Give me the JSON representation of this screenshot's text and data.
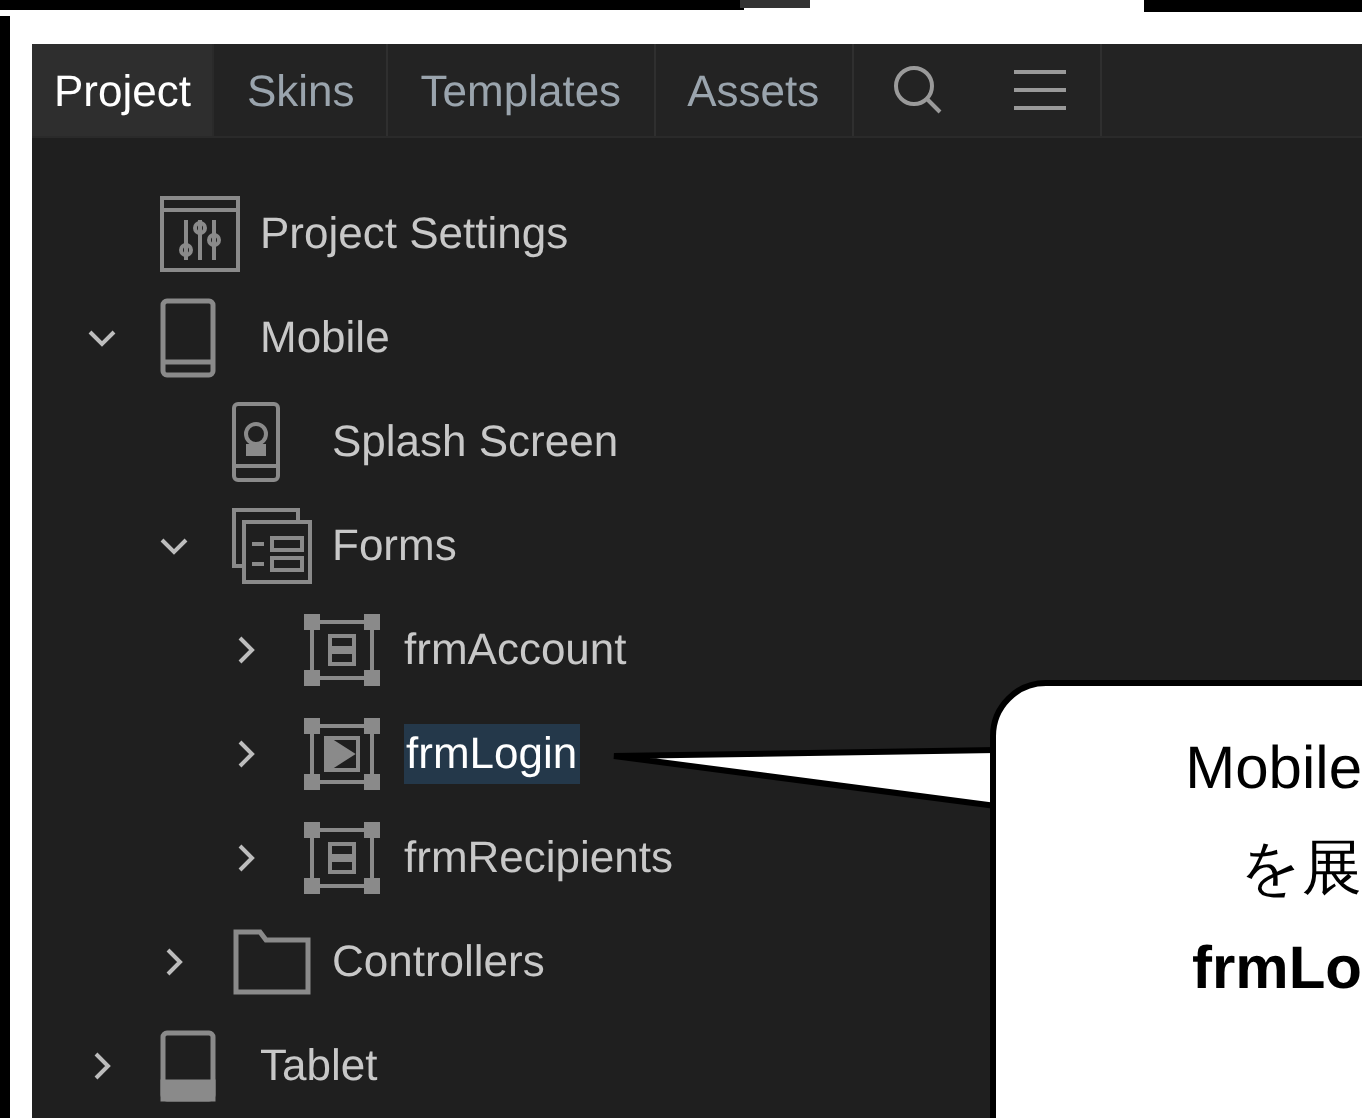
{
  "tabs": [
    {
      "label": "Project",
      "selected": true
    },
    {
      "label": "Skins",
      "selected": false
    },
    {
      "label": "Templates",
      "selected": false
    },
    {
      "label": "Assets",
      "selected": false
    }
  ],
  "tree": [
    {
      "label": "Project Settings",
      "kind": "settings",
      "selected": false
    },
    {
      "label": "Mobile",
      "kind": "phone",
      "expanded": true,
      "selected": false,
      "children": [
        {
          "label": "Splash Screen",
          "kind": "splash",
          "selected": false
        },
        {
          "label": "Forms",
          "kind": "forms",
          "expanded": true,
          "selected": false,
          "children": [
            {
              "label": "frmAccount",
              "kind": "form",
              "expanded": false,
              "selected": false
            },
            {
              "label": "frmLogin",
              "kind": "form-play",
              "expanded": false,
              "selected": true
            },
            {
              "label": "frmRecipients",
              "kind": "form",
              "expanded": false,
              "selected": false
            }
          ]
        },
        {
          "label": "Controllers",
          "kind": "folder",
          "expanded": false,
          "selected": false
        }
      ]
    },
    {
      "label": "Tablet",
      "kind": "tablet",
      "expanded": false,
      "selected": false
    }
  ],
  "callout": {
    "lines": [
      "Mobile",
      "を展",
      "**frmLo**"
    ]
  }
}
